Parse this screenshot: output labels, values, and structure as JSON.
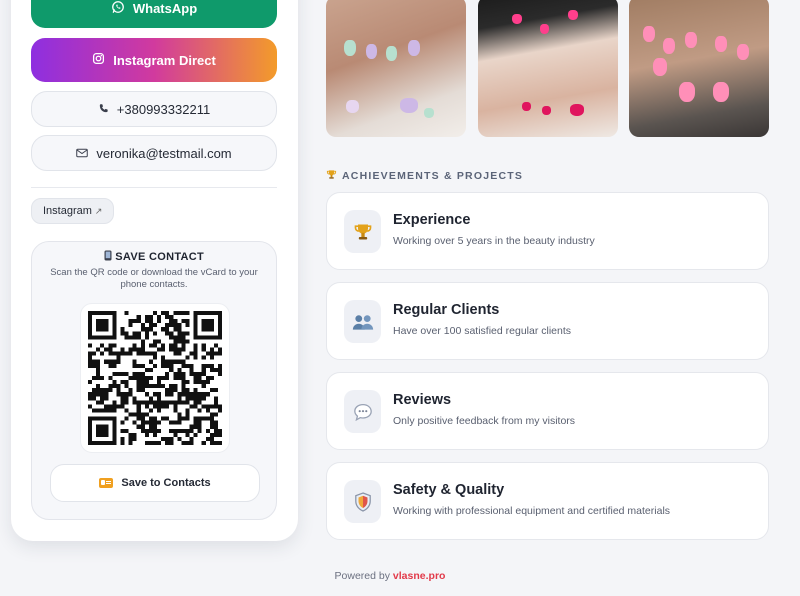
{
  "contact": {
    "whatsapp_label": "WhatsApp",
    "instagram_direct_label": "Instagram Direct",
    "phone": "+380993332211",
    "email": "veronika@testmail.com"
  },
  "social_links": [
    {
      "label": "Instagram",
      "external_indicator": "↗"
    }
  ],
  "save_contact": {
    "title": "SAVE CONTACT",
    "title_icon": "mobile-phone-icon",
    "description": "Scan the QR code or download the vCard to your phone contacts.",
    "button_label": "Save to Contacts",
    "button_icon": "contact-card-icon"
  },
  "gallery": {
    "photos": [
      {
        "name": "gallery-photo-1"
      },
      {
        "name": "gallery-photo-2"
      },
      {
        "name": "gallery-photo-3"
      }
    ]
  },
  "achievements": {
    "section_title": "ACHIEVEMENTS & PROJECTS",
    "section_icon": "trophy-icon",
    "items": [
      {
        "title": "Experience",
        "description": "Working over 5 years in the beauty industry",
        "icon": "trophy-icon"
      },
      {
        "title": "Regular Clients",
        "description": "Have over 100 satisfied regular clients",
        "icon": "people-icon"
      },
      {
        "title": "Reviews",
        "description": "Only positive feedback from my visitors",
        "icon": "speech-bubble-icon"
      },
      {
        "title": "Safety & Quality",
        "description": "Working with professional equipment and certified materials",
        "icon": "shield-icon"
      }
    ]
  },
  "footer": {
    "powered_by_label": "Powered by",
    "brand": "vlasne.pro"
  },
  "colors": {
    "whatsapp": "#0f9a6b",
    "instagram_gradient": [
      "#8e2fe0",
      "#d13a9e",
      "#f39b2a"
    ],
    "brand_accent": "#e23a4a"
  }
}
